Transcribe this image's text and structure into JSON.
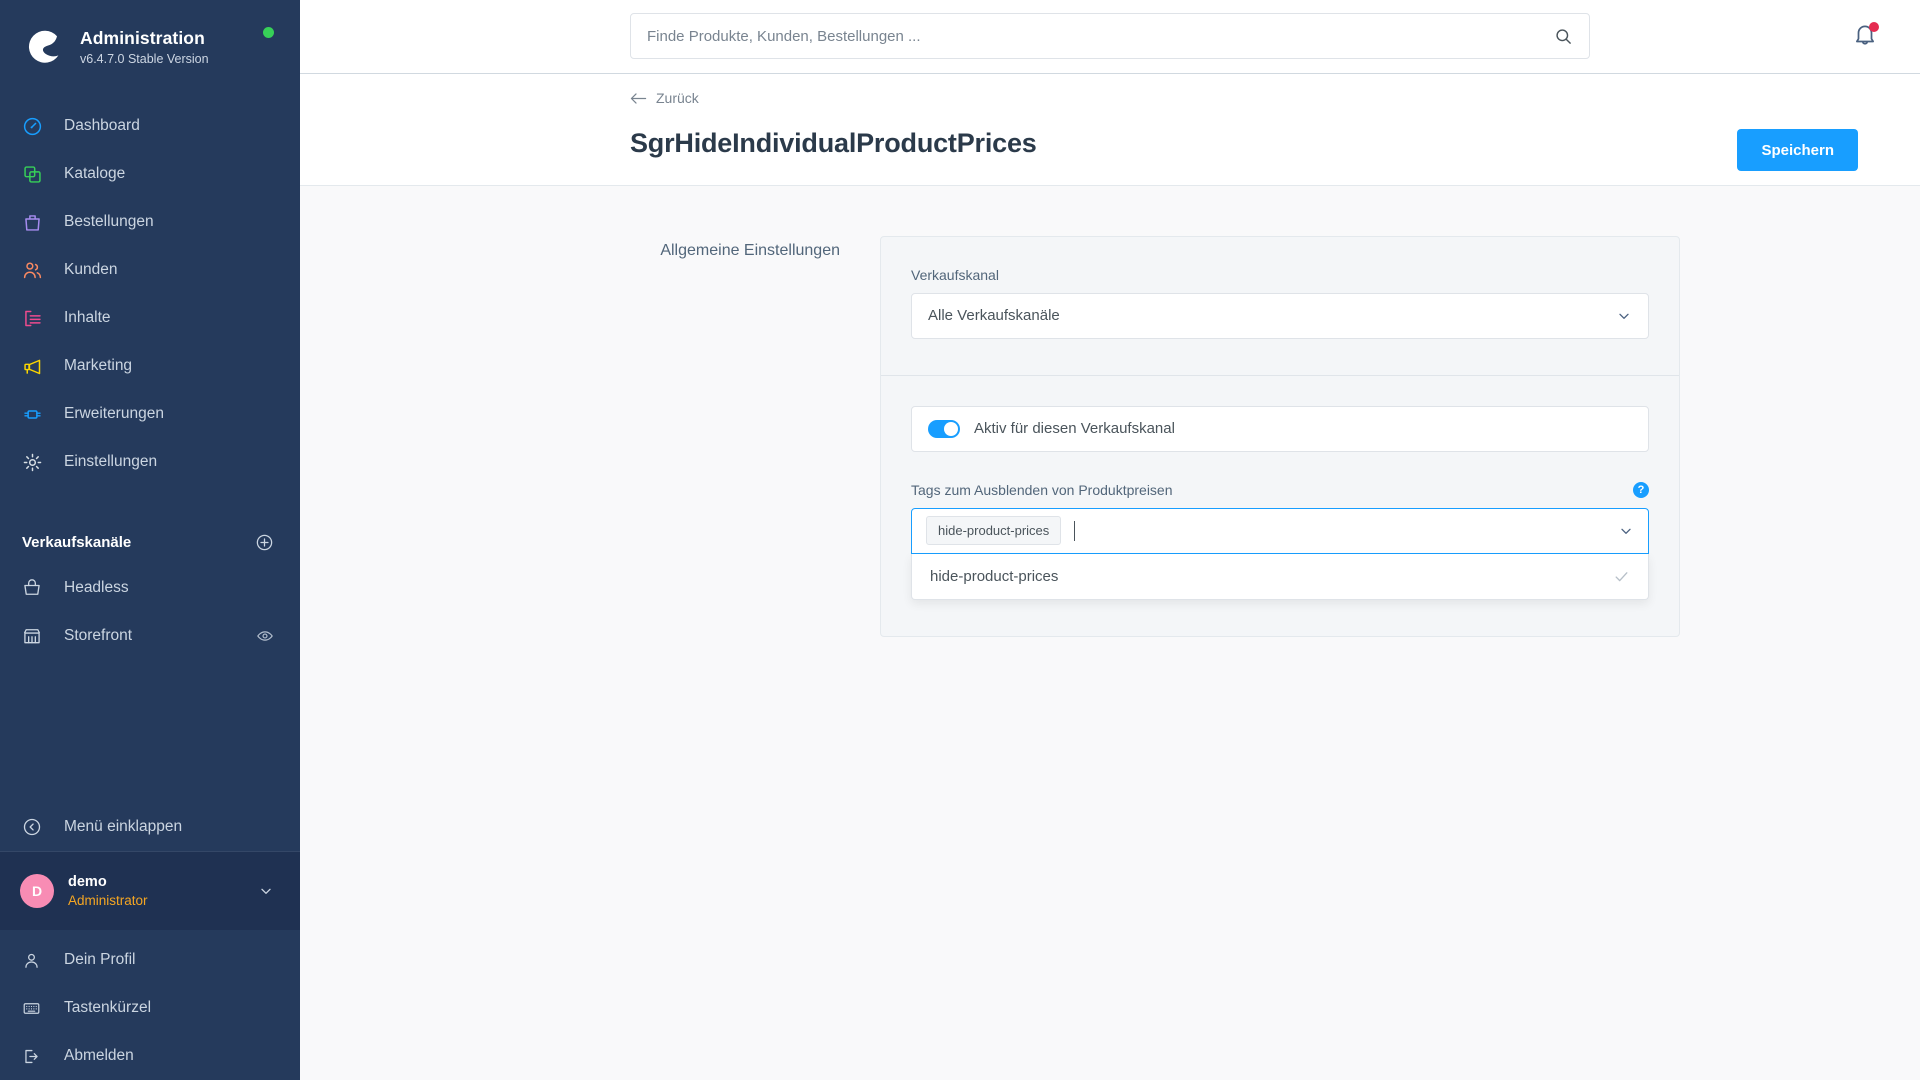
{
  "sidebar": {
    "brand": {
      "title": "Administration",
      "version": "v6.4.7.0 Stable Version",
      "logo_icon": "shopware-logo-icon",
      "status_icon": "status-online-dot"
    },
    "nav": [
      {
        "label": "Dashboard",
        "icon": "dashboard-icon",
        "color": "#189eff"
      },
      {
        "label": "Kataloge",
        "icon": "catalog-icon",
        "color": "#37d058"
      },
      {
        "label": "Bestellungen",
        "icon": "orders-bag-icon",
        "color": "#a68cf0"
      },
      {
        "label": "Kunden",
        "icon": "customers-icon",
        "color": "#f88962"
      },
      {
        "label": "Inhalte",
        "icon": "content-icon",
        "color": "#ef4b8e"
      },
      {
        "label": "Marketing",
        "icon": "megaphone-icon",
        "color": "#fbd500"
      },
      {
        "label": "Erweiterungen",
        "icon": "plugin-icon",
        "color": "#189eff"
      },
      {
        "label": "Einstellungen",
        "icon": "gear-icon",
        "color": "#d8dfe5"
      }
    ],
    "channels_section": {
      "title": "Verkaufskanäle",
      "add_icon": "plus-circle-icon",
      "items": [
        {
          "label": "Headless",
          "icon": "basket-icon",
          "trailing_icon": null
        },
        {
          "label": "Storefront",
          "icon": "storefront-icon",
          "trailing_icon": "eye-icon"
        }
      ]
    },
    "collapse": {
      "label": "Menü einklappen",
      "icon": "chevron-circle-left-icon"
    },
    "user": {
      "initial": "D",
      "name": "demo",
      "role": "Administrator",
      "chevron_icon": "chevron-down-icon"
    },
    "user_menu": [
      {
        "label": "Dein Profil",
        "icon": "person-icon"
      },
      {
        "label": "Tastenkürzel",
        "icon": "keyboard-icon"
      },
      {
        "label": "Abmelden",
        "icon": "logout-icon"
      }
    ]
  },
  "topbar": {
    "search": {
      "placeholder": "Finde Produkte, Kunden, Bestellungen ...",
      "value": "",
      "icon": "search-icon"
    },
    "notifications": {
      "icon": "bell-icon",
      "has_unread": true,
      "badge_color": "#e52b50"
    }
  },
  "page": {
    "back_link": {
      "label": "Zurück",
      "icon": "arrow-left-icon"
    },
    "title": "SgrHideIndividualProductPrices",
    "save_button": {
      "label": "Speichern",
      "color": "#189eff"
    }
  },
  "settings": {
    "section_label": "Allgemeine Einstellungen",
    "sales_channel": {
      "label": "Verkaufskanal",
      "value": "Alle Verkaufskanäle",
      "chevron_icon": "chevron-down-icon"
    },
    "active_toggle": {
      "label": "Aktiv für diesen Verkaufskanal",
      "checked": true
    },
    "tags_field": {
      "label": "Tags zum Ausblenden von Produktpreisen",
      "help_icon": "help-question-icon",
      "selected_tags": [
        "hide-product-prices"
      ],
      "input_value": "",
      "chevron_icon": "chevron-down-icon",
      "dropdown_open": true,
      "options": [
        {
          "label": "hide-product-prices",
          "selected": true,
          "check_icon": "check-icon"
        }
      ]
    }
  }
}
